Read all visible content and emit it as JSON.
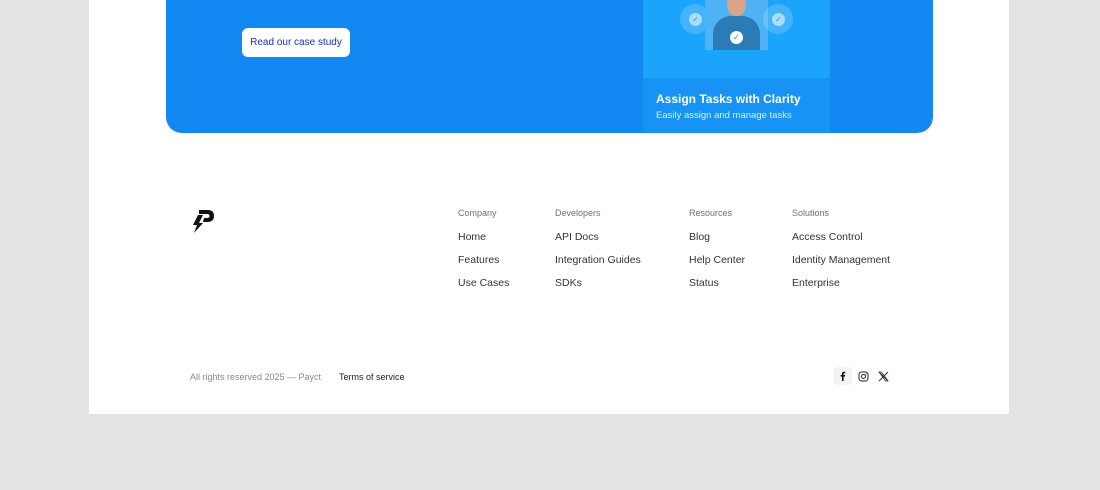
{
  "hero": {
    "cta_label": "Read our case study",
    "card": {
      "title": "Assign Tasks with Clarity",
      "subtitle": "Easily assign and manage tasks"
    }
  },
  "footer": {
    "logo_icon": "payct-logo-icon",
    "columns": [
      {
        "heading": "Company",
        "links": [
          "Home",
          "Features",
          "Use Cases"
        ]
      },
      {
        "heading": "Developers",
        "links": [
          "API Docs",
          "Integration Guides",
          "SDKs"
        ]
      },
      {
        "heading": "Resources",
        "links": [
          "Blog",
          "Help Center",
          "Status"
        ]
      },
      {
        "heading": "Solutions",
        "links": [
          "Access Control",
          "Identity Management",
          "Enterprise"
        ]
      }
    ],
    "copyright": "All rights reserved 2025 — Payct",
    "terms_label": "Terms of service",
    "social_icons": [
      "facebook-icon",
      "instagram-icon",
      "x-icon"
    ]
  },
  "colors": {
    "page_background": "#e3e3e6",
    "hero_blue": "#1288f3",
    "card_blue": "#1aa4fb",
    "cta_text": "#1730b8"
  }
}
